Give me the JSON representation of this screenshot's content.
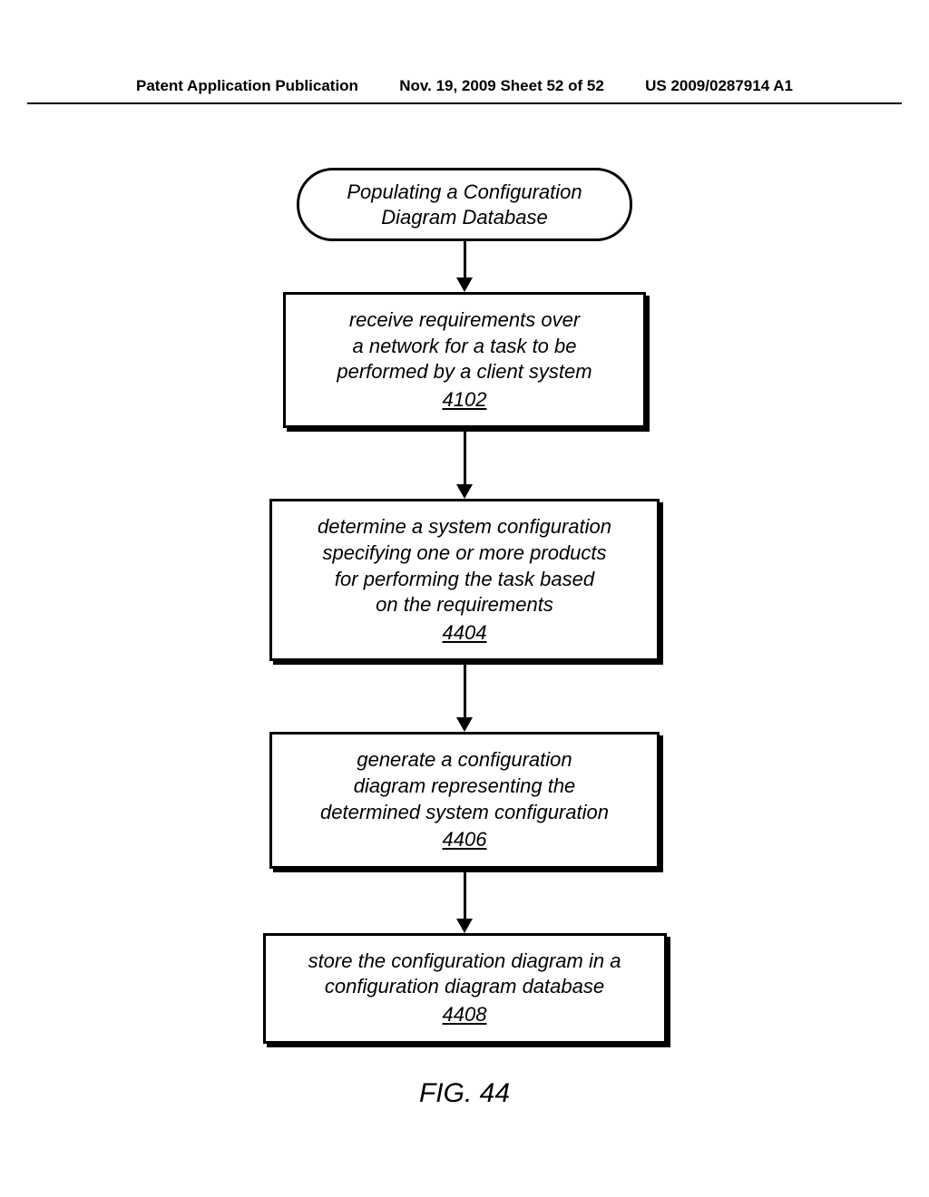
{
  "header": {
    "left": "Patent Application Publication",
    "center": "Nov. 19, 2009  Sheet 52 of 52",
    "right": "US 2009/0287914 A1"
  },
  "flowchart": {
    "terminal": {
      "line1": "Populating a Configuration",
      "line2": "Diagram Database"
    },
    "step1": {
      "line1": "receive requirements over",
      "line2": "a network for a task to be",
      "line3": "performed by a client system",
      "ref": "4102"
    },
    "step2": {
      "line1": "determine a system configuration",
      "line2": "specifying one or more products",
      "line3": "for performing the task based",
      "line4": "on the requirements",
      "ref": "4404"
    },
    "step3": {
      "line1": "generate a configuration",
      "line2": "diagram representing the",
      "line3": "determined system configuration",
      "ref": "4406"
    },
    "step4": {
      "line1": "store the configuration diagram in a",
      "line2": "configuration diagram database",
      "ref": "4408"
    }
  },
  "caption": "FIG. 44"
}
